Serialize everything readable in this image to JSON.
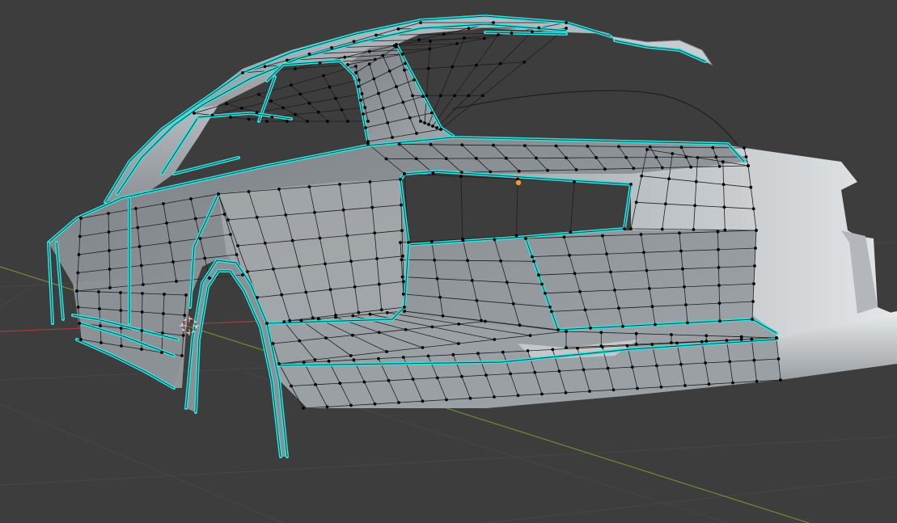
{
  "viewport": {
    "background": "#3d3d3d",
    "grid_color": "#474747",
    "axis_x_color": "#a83a3a",
    "axis_y_color": "#6e8c32"
  },
  "mesh": {
    "surface_color": "#9ea3a8",
    "surface_light": "#d9dde0",
    "surface_dark": "#6d7277",
    "wire_color": "#1e1e1e",
    "vertex_color": "#000000",
    "seam_color": "#2fe3e0"
  },
  "scene_markers": {
    "origin_color": "#ff9a1a",
    "cursor_outer": "#e0e0e0",
    "cursor_accent": "#d04040"
  },
  "icons": [
    "origin-point-icon",
    "3d-cursor-icon"
  ]
}
